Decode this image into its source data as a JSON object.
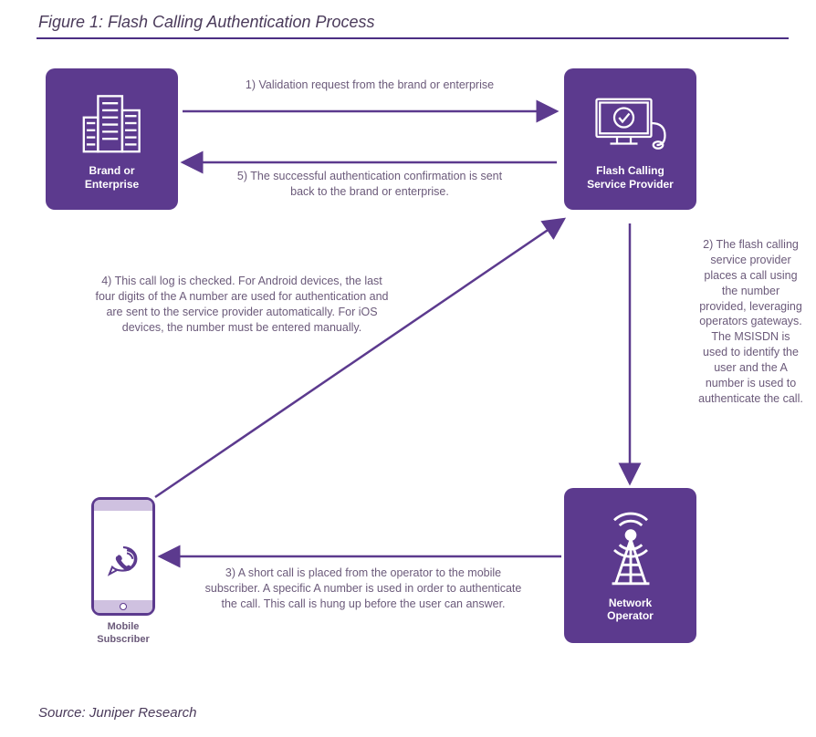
{
  "title": "Figure 1: Flash Calling Authentication Process",
  "source": "Source: Juniper Research",
  "nodes": {
    "brand": {
      "label": "Brand or\nEnterprise"
    },
    "provider": {
      "label": "Flash Calling\nService Provider"
    },
    "operator": {
      "label": "Network\nOperator"
    },
    "subscriber": {
      "label": "Mobile\nSubscriber"
    }
  },
  "steps": {
    "s1": "1) Validation request from the brand or enterprise",
    "s2": "2) The flash calling service provider places a call using the number provided, leveraging operators gateways. The MSISDN is used to identify the user and the A number is used to authenticate the call.",
    "s3": "3) A short call is placed from the operator to the mobile subscriber. A specific A number is used in order to authenticate the call. This call is hung up before the user can answer.",
    "s4": "4) This call log is checked. For Android devices, the last four digits of the A number are used for authentication and are sent to the service provider automatically. For iOS devices, the number must be entered manually.",
    "s5": "5) The successful authentication confirmation is sent back to the brand or enterprise."
  },
  "colors": {
    "primary": "#5c3a8e",
    "text": "#6b5a7a"
  }
}
